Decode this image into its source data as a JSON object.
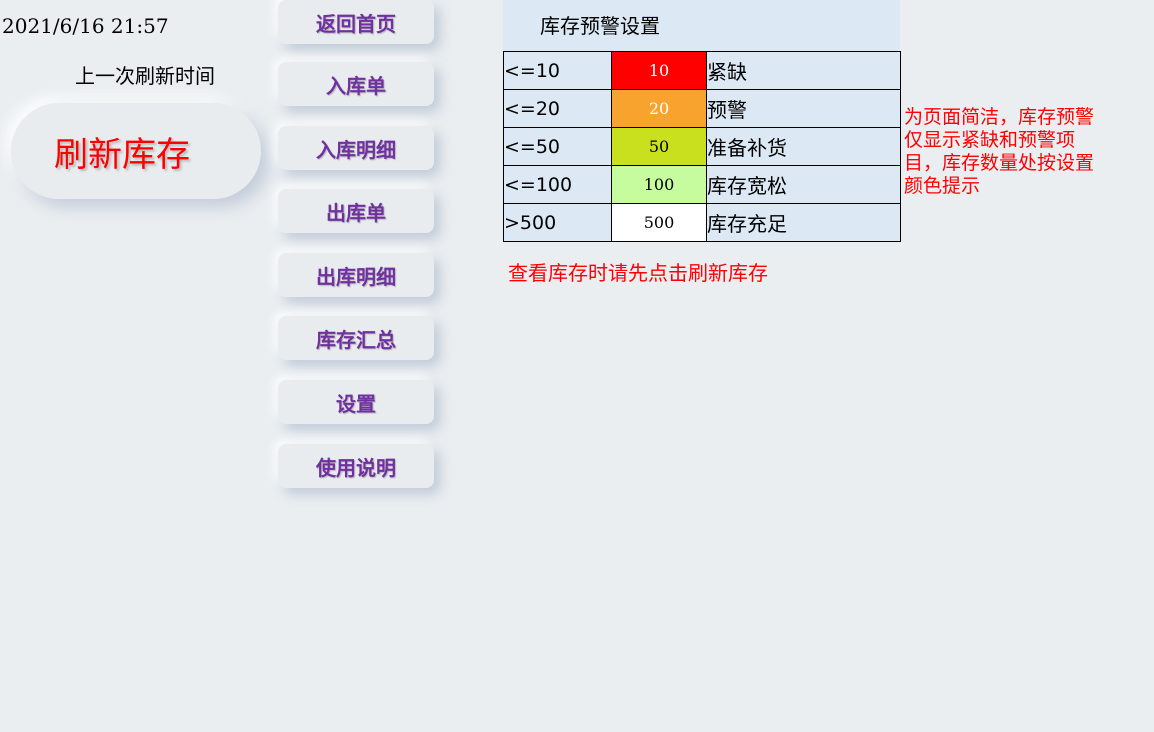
{
  "header": {
    "datetime": "2021/6/16 21:57",
    "last_refresh_label": "上一次刷新时间",
    "refresh_button_label": "刷新库存"
  },
  "nav": {
    "items": [
      {
        "label": "返回首页"
      },
      {
        "label": "入库单"
      },
      {
        "label": "入库明细"
      },
      {
        "label": "出库单"
      },
      {
        "label": "出库明细"
      },
      {
        "label": "库存汇总"
      },
      {
        "label": "设置"
      },
      {
        "label": "使用说明"
      }
    ]
  },
  "settings": {
    "title": "库存预警设置",
    "rows": [
      {
        "condition": "<=10",
        "value": "10",
        "description": "紧缺",
        "bg_color": "#ff0000",
        "text_color": "#ffffff"
      },
      {
        "condition": "<=20",
        "value": "20",
        "description": "预警",
        "bg_color": "#f7a32e",
        "text_color": "#ffffff"
      },
      {
        "condition": "<=50",
        "value": "50",
        "description": "准备补货",
        "bg_color": "#c8e01e",
        "text_color": "#000000"
      },
      {
        "condition": "<=100",
        "value": "100",
        "description": "库存宽松",
        "bg_color": "#c6fc9e",
        "text_color": "#000000"
      },
      {
        "condition": ">500",
        "value": "500",
        "description": "库存充足",
        "bg_color": "#ffffff",
        "text_color": "#000000"
      }
    ]
  },
  "notes": {
    "side_note": "为页面简洁，库存预警仅显示紧缺和预警项目，库存数量处按设置颜色提示",
    "bottom_note": "查看库存时请先点击刷新库存"
  },
  "colors": {
    "background": "#eaeef1",
    "nav_text": "#7030a0",
    "alert_text": "#ff0000",
    "table_bg": "#dce9f5"
  }
}
